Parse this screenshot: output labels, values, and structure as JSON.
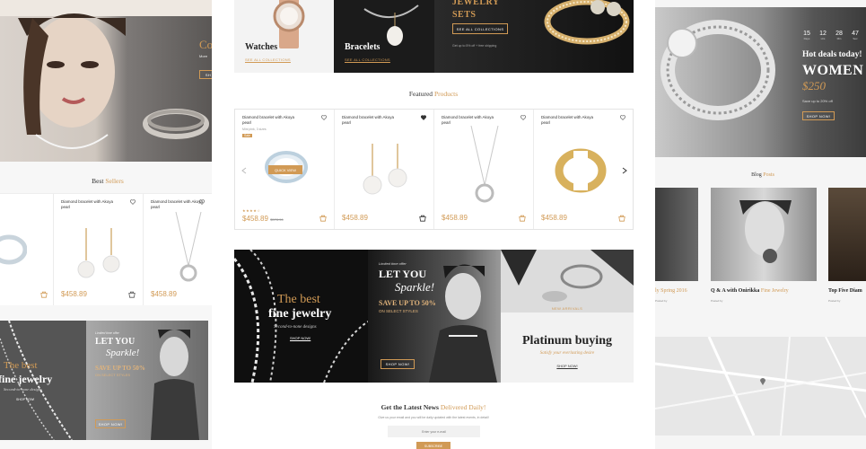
{
  "center": {
    "categories": [
      {
        "title": "Watches",
        "link": "SEE ALL COLLECTIONS"
      },
      {
        "title": "Bracelets",
        "link": "SEE ALL COLLECTIONS"
      }
    ],
    "jewelry_sets": {
      "title": "JEWELRY SETS",
      "button": "SEE ALL COLLECTIONS",
      "note": "Get up to 5% off + free shipping"
    },
    "featured": {
      "title_a": "Featured",
      "title_b": "Products"
    },
    "products": [
      {
        "name": "Diamond bracelet with Akoya pearl",
        "sub": "Mini pink, 3 sizes",
        "badge": "Sale",
        "price": "$458.89",
        "old_price": "$578.96",
        "quick_view": "QUICK VIEW",
        "stars": "★★★★☆"
      },
      {
        "name": "Diamond bracelet with Akoya pearl",
        "price": "$458.89"
      },
      {
        "name": "Diamond bracelet with Akoya pearl",
        "price": "$458.89"
      },
      {
        "name": "Diamond bracelet with Akoya pearl",
        "price": "$458.89"
      }
    ],
    "banners": {
      "best": {
        "line1": "The best",
        "line2": "fine jewelry",
        "line3": "Second-to-none designs",
        "button": "SHOP NOW!"
      },
      "sparkle": {
        "kicker": "Limited time offer",
        "line1": "LET YOU",
        "line2": "Sparkle!",
        "line3": "SAVE UP TO 50%",
        "line4": "ON SELECT STYLES",
        "button": "SHOP NOW!"
      },
      "platinum": {
        "kicker": "NEW ARRIVALS",
        "title": "Platinum buying",
        "sub": "Satisfy your everlasting desire",
        "button": "SHOP NOW!"
      }
    },
    "newsletter": {
      "title_a": "Get the Latest News",
      "title_b": "Delivered Daily!",
      "desc": "Give us your email and you will be daily updated with the latest events, in detail!",
      "placeholder": "Enter your e-mail",
      "button": "SUBSCRIBE"
    }
  },
  "left": {
    "hero": {
      "title": "Co",
      "sub": "More",
      "button": "SH"
    },
    "best_sellers": {
      "title_a": "Best",
      "title_b": "Sellers"
    },
    "products": [
      {
        "name": "Diamond bracelet with Akoya pearl",
        "price": "$458.89"
      },
      {
        "name": "Diamond bracelet with Akoya pearl",
        "price": "$458.89"
      }
    ],
    "banners": {
      "best": {
        "line1": "The best",
        "line2": "fine jewelry",
        "line3": "Second-to-none designs",
        "button": "SHOP NOW!"
      },
      "sparkle": {
        "kicker": "Limited time offer",
        "line1": "LET YOU",
        "line2": "Sparkle!",
        "line3": "SAVE UP TO 50%",
        "line4": "ON SELECT STYLES",
        "button": "SHOP NOW!"
      }
    }
  },
  "right": {
    "countdown": [
      {
        "value": "15",
        "label": "Days"
      },
      {
        "value": "12",
        "label": "Hrs"
      },
      {
        "value": "28",
        "label": "Min"
      },
      {
        "value": "47",
        "label": "Sec"
      }
    ],
    "hot": {
      "title": "Hot deals today!",
      "big": "WOMEN R",
      "price": "$250",
      "save": "Save up to 20% off",
      "button": "SHOP NOW!"
    },
    "blog": {
      "title_a": "Blog",
      "title_b": "Posts"
    },
    "posts": [
      {
        "title": "ly Spring 2016",
        "meta": "Posted by"
      },
      {
        "title_a": "Q & A with Onirikka",
        "title_b": "Fine Jewelry",
        "meta": "Posted by"
      },
      {
        "title": "Top Five Diam",
        "meta": "Posted by"
      }
    ]
  },
  "colors": {
    "accent": "#d19a55",
    "dark": "#1e1e1e"
  }
}
